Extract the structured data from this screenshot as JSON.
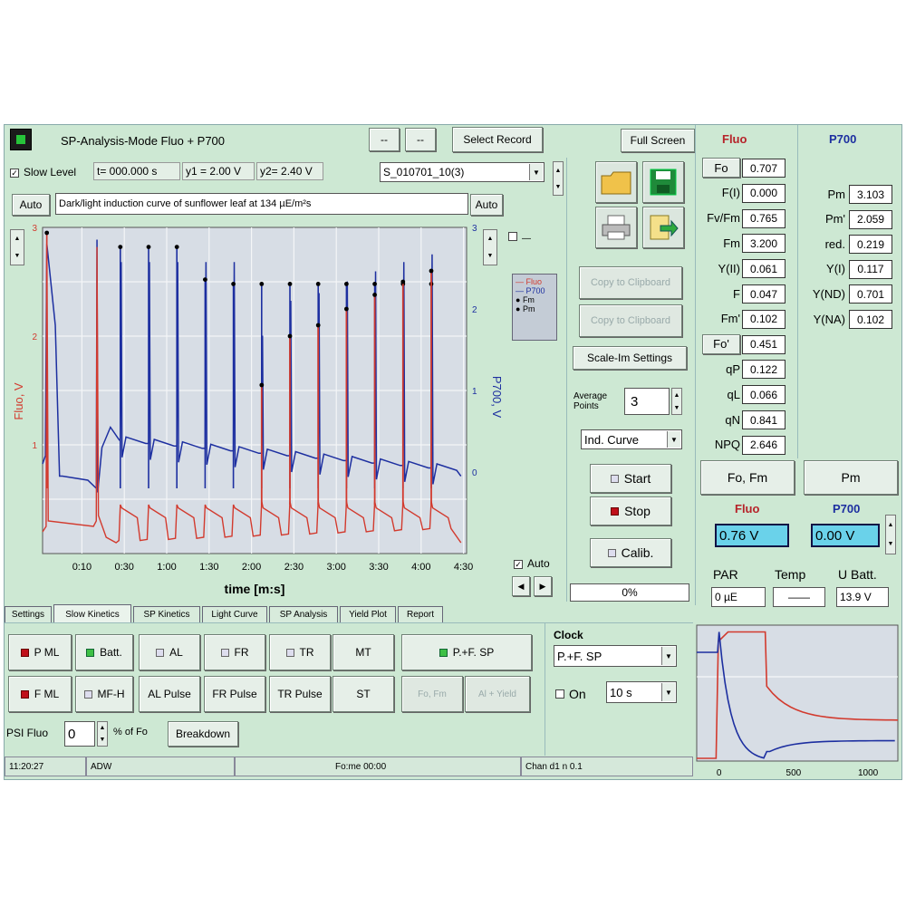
{
  "window": {
    "title": "SP-Analysis-Mode   Fluo + P700"
  },
  "toolbar": {
    "left_btn": "--",
    "right_btn": "--",
    "select_record": "Select Record",
    "full_screen": "Full Screen"
  },
  "chart_header": {
    "slow_level_label": "Slow Level",
    "t_readout": "t= 000.000 s",
    "y1_readout": "y1 = 2.00 V",
    "y2_readout": "y2= 2.40 V",
    "record_select": "S_010701_10(3)",
    "auto_left": "Auto",
    "auto_right": "Auto",
    "comment": "Dark/light induction curve of sunflower leaf at 134 µE/m²s"
  },
  "chart_data": {
    "type": "line",
    "xlabel": "time [m:s]",
    "ylabel_left": "Fluo, V",
    "ylabel_right": "P700, V",
    "x_ticks": [
      "0:10",
      "0:30",
      "1:00",
      "1:30",
      "2:00",
      "2:30",
      "3:00",
      "3:30",
      "4:00",
      "4:30"
    ],
    "xlim": [
      0,
      300
    ],
    "ylim_left": [
      0,
      3
    ],
    "ylim_right": [
      -1,
      3
    ],
    "y_left_ticks": [
      "1",
      "2",
      "3"
    ],
    "y_right_ticks": [
      "0",
      "1",
      "2",
      "3"
    ],
    "grid": true,
    "pulse_times": [
      3,
      38,
      55,
      75,
      95,
      115,
      135,
      155,
      175,
      195,
      215,
      235,
      255,
      275
    ],
    "fm_points": [
      2.95,
      2.82,
      2.82,
      2.82,
      2.82,
      2.82,
      2.82,
      2.82,
      2.82,
      2.82,
      2.82,
      2.82,
      2.82,
      2.82
    ],
    "fm_prime_points": [
      0,
      0,
      0,
      0,
      0,
      0,
      0,
      1.55,
      2.0,
      2.1,
      2.25,
      2.38,
      2.5,
      2.6
    ],
    "pm_points": [
      2.95,
      0,
      2.82,
      2.82,
      2.82,
      2.52,
      2.48,
      2.48,
      2.48,
      2.48,
      2.48,
      2.48,
      2.48,
      2.48
    ],
    "series": [
      {
        "name": "Fluo",
        "color": "#d23a2e"
      },
      {
        "name": "P700",
        "color": "#1d2fa0"
      },
      {
        "name": "Fm",
        "color": "#000000"
      },
      {
        "name": "Pm",
        "color": "#000000"
      }
    ],
    "legend": [
      "Fluo",
      "P700",
      "Fm",
      "Pm"
    ],
    "legend_position": "right"
  },
  "chart_controls": {
    "auto_label": "Auto"
  },
  "center_panel": {
    "copy_btn1": "Copy to Clipboard",
    "copy_btn2": "Copy to Clipboard",
    "scale_settings": "Scale-Im Settings",
    "average_points_label": "Average Points",
    "average_points_value": "3",
    "curve_select": "Ind. Curve",
    "start": "Start",
    "stop": "Stop",
    "calib": "Calib.",
    "progress": "0%"
  },
  "fluo_params": {
    "title": "Fluo",
    "rows": [
      {
        "label": "Fo",
        "value": "0.707"
      },
      {
        "label": "F(I)",
        "value": "0.000"
      },
      {
        "label": "Fv/Fm",
        "value": "0.765"
      },
      {
        "label": "Fm",
        "value": "3.200"
      },
      {
        "label": "Y(II)",
        "value": "0.061"
      },
      {
        "label": "F",
        "value": "0.047"
      },
      {
        "label": "Fm'",
        "value": "0.102"
      },
      {
        "label": "Fo'",
        "value": "0.451"
      },
      {
        "label": "qP",
        "value": "0.122"
      },
      {
        "label": "qL",
        "value": "0.066"
      },
      {
        "label": "qN",
        "value": "0.841"
      },
      {
        "label": "NPQ",
        "value": "2.646"
      }
    ]
  },
  "p700_params": {
    "title": "P700",
    "rows": [
      {
        "label": "Pm",
        "value": "3.103"
      },
      {
        "label": "Pm'",
        "value": "2.059"
      },
      {
        "label": "red.",
        "value": "0.219"
      },
      {
        "label": "Y(I)",
        "value": "0.117"
      },
      {
        "label": "Y(ND)",
        "value": "0.701"
      },
      {
        "label": "Y(NA)",
        "value": "0.102"
      }
    ]
  },
  "right_buttons": {
    "fo_fm": "Fo, Fm",
    "pm": "Pm"
  },
  "readouts": {
    "fluo_label": "Fluo",
    "fluo_value": "0.76 V",
    "p700_label": "P700",
    "p700_value": "0.00 V",
    "par_label": "PAR",
    "par_value": "0 µE",
    "temp_label": "Temp",
    "temp_value": "——",
    "ubatt_label": "U Batt.",
    "ubatt_value": "13.9 V"
  },
  "tabs": [
    "Settings",
    "Slow Kinetics",
    "SP Kinetics",
    "Light Curve",
    "SP Analysis",
    "Yield Plot",
    "Report"
  ],
  "active_tab": 1,
  "controls": {
    "pml1": "P ML",
    "batt": "Batt.",
    "al": "AL",
    "fr": "FR",
    "tr": "TR",
    "mt": "MT",
    "pfsp": "P.+F. SP",
    "pml2": "F ML",
    "mfh": "MF-H",
    "al_pulse": "AL Pulse",
    "fr_pulse": "FR Pulse",
    "tr_pulse": "TR Pulse",
    "st": "ST",
    "dis1": "Fo, Fm",
    "dis2": "Al + Yield",
    "psi_label": "PSI Fluo",
    "psi_value": "0",
    "psi_unit": "% of Fo",
    "breakdown": "Breakdown"
  },
  "clock": {
    "title": "Clock",
    "select": "P.+F. SP",
    "on_label": "On",
    "interval": "10 s"
  },
  "mini_chart": {
    "type": "line",
    "x_ticks": [
      "0",
      "500",
      "1000"
    ],
    "xlim": [
      -150,
      1200
    ],
    "ylim": [
      0,
      1
    ],
    "series": [
      {
        "name": "Fluo",
        "color": "#d23a2e"
      },
      {
        "name": "P700",
        "color": "#1d2fa0"
      }
    ]
  },
  "status_bar": {
    "time": "11:20:27",
    "mode": "ADW",
    "file": "Fo:me 00:00",
    "channel": "Chan d1 n 0.1"
  }
}
